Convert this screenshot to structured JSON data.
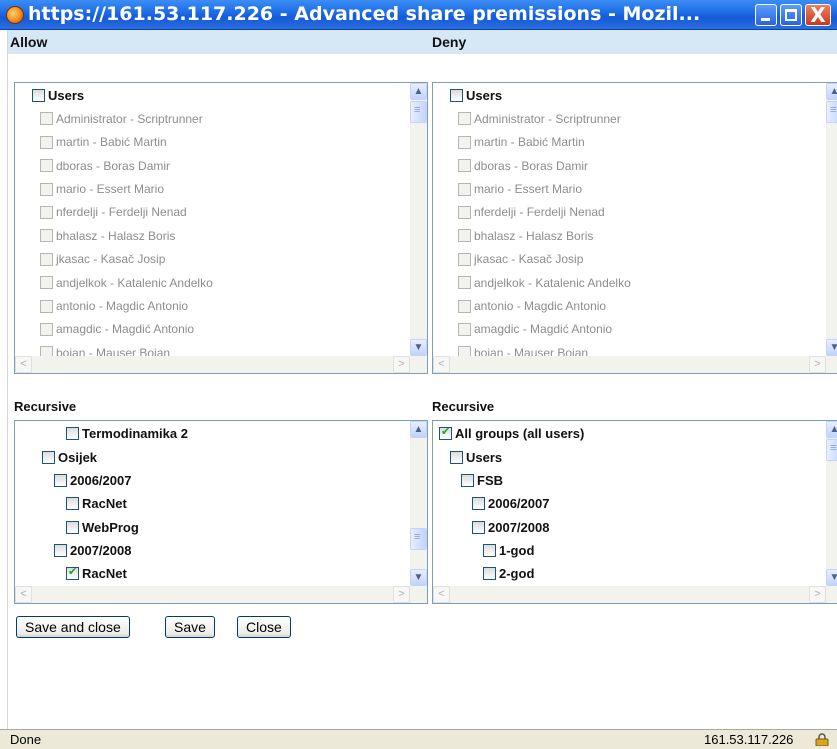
{
  "window": {
    "title": "https://161.53.117.226 - Advanced share premissions - Mozil...",
    "icon": "firefox-icon",
    "close_glyph": "X"
  },
  "columns": {
    "allow": "Allow",
    "deny": "Deny"
  },
  "users_tree": {
    "root": "Users",
    "items": [
      "Administrator - Scriptrunner",
      "martin - Babić Martin",
      "dboras - Boras Damir",
      "mario - Essert Mario",
      "nferdelji - Ferdelji Nenad",
      "bhalasz - Halasz Boris",
      "jkasac - Kasač Josip",
      "andjelkok - Katalenic Andelko",
      "antonio - Magdic Antonio",
      "amagdic - Magdić Antonio",
      "bojan - Mauser Bojan"
    ]
  },
  "recursive": {
    "left_label": "Recursive",
    "right_label": "Recursive",
    "left_items": [
      {
        "label": "Termodinamika 2",
        "checked": false
      },
      {
        "label": "Osijek",
        "checked": false
      },
      {
        "label": "2006/2007",
        "checked": false
      },
      {
        "label": "RacNet",
        "checked": false
      },
      {
        "label": "WebProg",
        "checked": false
      },
      {
        "label": "2007/2008",
        "checked": false
      },
      {
        "label": "RacNet",
        "checked": true
      }
    ],
    "right_items": [
      {
        "label": "All groups (all users)",
        "checked": true
      },
      {
        "label": "Users",
        "checked": false
      },
      {
        "label": "FSB",
        "checked": false
      },
      {
        "label": "2006/2007",
        "checked": false
      },
      {
        "label": "2007/2008",
        "checked": false
      },
      {
        "label": "1-god",
        "checked": false
      },
      {
        "label": "2-god",
        "checked": false
      }
    ]
  },
  "buttons": {
    "save_close": "Save and close",
    "save": "Save",
    "close": "Close"
  },
  "statusbar": {
    "status": "Done",
    "host": "161.53.117.226",
    "icon": "lock-icon"
  },
  "scroll_glyphs": {
    "up": "▲",
    "down": "▼",
    "left": "<",
    "right": ">"
  }
}
